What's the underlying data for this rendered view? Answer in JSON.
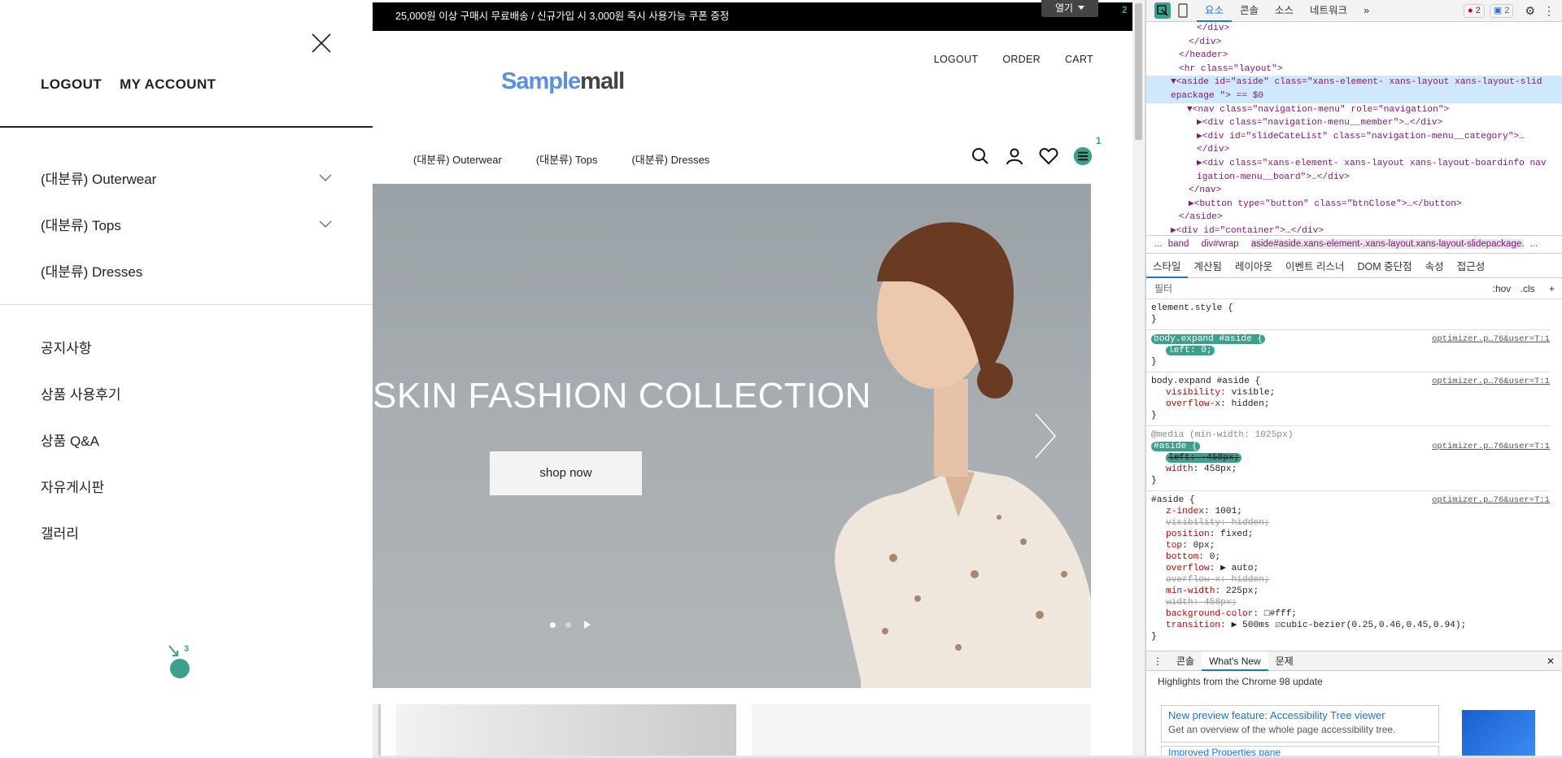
{
  "site": {
    "promo": "25,000원 이상 구매시 무료배송 / 신규가입 시 3,000원 즉시 사용가능 쿠폰 증정",
    "lang_button": "열기",
    "top_menu": [
      "LOGOUT",
      "ORDER",
      "CART"
    ],
    "logo_part1": "Sample",
    "logo_part2": "mall",
    "gnb": [
      "(대분류) Outerwear",
      "(대분류) Tops",
      "(대분류) Dresses"
    ],
    "icons": [
      "search-icon",
      "user-icon",
      "heart-icon",
      "hamburger-menu-icon"
    ],
    "hero": {
      "headline": "SKIN FASHION COLLECTION",
      "button": "shop now"
    }
  },
  "aside": {
    "account": [
      "LOGOUT",
      "MY ACCOUNT"
    ],
    "categories": [
      "(대분류) Outerwear",
      "(대분류) Tops",
      "(대분류) Dresses"
    ],
    "boards": [
      "공지사항",
      "상품 사용후기",
      "상품 Q&A",
      "자유게시판",
      "갤러리"
    ]
  },
  "markers": {
    "m1": "1",
    "m2": "2",
    "m3": "3"
  },
  "devtools": {
    "tabs": [
      "요소",
      "콘솔",
      "소스",
      "네트워크"
    ],
    "more": "»",
    "errors": "2",
    "messages": "2",
    "dom_lines": [
      "</div>",
      "</div>",
      "</header>",
      "<hr class=\"layout\">",
      "▼<aside id=\"aside\" class=\"xans-element- xans-layout xans-layout-slid",
      "epackage \"> == $0",
      "▼<nav class=\"navigation-menu\" role=\"navigation\">",
      "▶<div class=\"navigation-menu__member\">…</div>",
      "▶<div id=\"slideCateList\" class=\"navigation-menu__category\">…",
      "</div>",
      "▶<div class=\"xans-element- xans-layout xans-layout-boardinfo nav",
      "igation-menu__board\">…</div>",
      "</nav>",
      "▶<button type=\"button\" class=\"btnClose\">…</button>",
      "</aside>",
      "▶<div id=\"container\">…</div>"
    ],
    "breadcrumbs": [
      "...",
      "band",
      "div#wrap",
      "aside#aside.xans-element-.xans-layout.xans-layout-slidepackage.",
      "..."
    ],
    "subtabs": [
      "스타일",
      "계산됨",
      "레이아웃",
      "이벤트 리스너",
      "DOM 중단점",
      "속성",
      "접근성"
    ],
    "filter": {
      "label": "필터",
      "hov": ":hov",
      "cls": ".cls",
      "plus": "+"
    },
    "rules": [
      {
        "selector": "element.style {",
        "props": [],
        "close": "}",
        "source": ""
      },
      {
        "selector": "body.expand #aside {",
        "props": [
          {
            "n": "left",
            "v": "0;",
            "strike": false
          }
        ],
        "close": "}",
        "source": "optimizer.p…76&user=T:1"
      },
      {
        "selector": "body.expand #aside {",
        "props": [
          {
            "n": "visibility",
            "v": "visible;",
            "strike": false
          },
          {
            "n": "overflow-x",
            "v": "hidden;",
            "strike": false
          }
        ],
        "close": "}",
        "source": "optimizer.p…76&user=T:1"
      },
      {
        "selector": "#aside {",
        "media": "@media (min-width: 1025px)",
        "props": [
          {
            "n": "left",
            "v": "-458px;",
            "strike": true
          },
          {
            "n": "width",
            "v": "458px;",
            "strike": false
          }
        ],
        "close": "}",
        "source": "optimizer.p…76&user=T:1"
      },
      {
        "selector": "#aside {",
        "props": [
          {
            "n": "z-index",
            "v": "1001;",
            "strike": false
          },
          {
            "n": "visibility",
            "v": "hidden;",
            "strike": true
          },
          {
            "n": "position",
            "v": "fixed;",
            "strike": false
          },
          {
            "n": "top",
            "v": "0px;",
            "strike": false
          },
          {
            "n": "bottom",
            "v": "0;",
            "strike": false
          },
          {
            "n": "overflow",
            "v": "▶ auto;",
            "strike": false
          },
          {
            "n": "overflow-x",
            "v": "hidden;",
            "strike": true
          },
          {
            "n": "min-width",
            "v": "225px;",
            "strike": false
          },
          {
            "n": "width",
            "v": "458px;",
            "strike": true
          },
          {
            "n": "background-color",
            "v": "□#fff;",
            "strike": false
          },
          {
            "n": "transition",
            "v": "▶ 500ms ☑cubic-bezier(0.25,0.46,0.45,0.94);",
            "strike": false
          }
        ],
        "close": "}",
        "source": "optimizer.p…76&user=T:1"
      }
    ],
    "drawer": {
      "tabs": [
        "콘솔",
        "What's New",
        "문제"
      ],
      "close": "✕",
      "headline": "Highlights from the Chrome 98 update",
      "card_title": "New preview feature: Accessibility Tree viewer",
      "card_text": "Get an overview of the whole page accessibility tree.",
      "card2_title": "Improved Properties pane"
    }
  }
}
